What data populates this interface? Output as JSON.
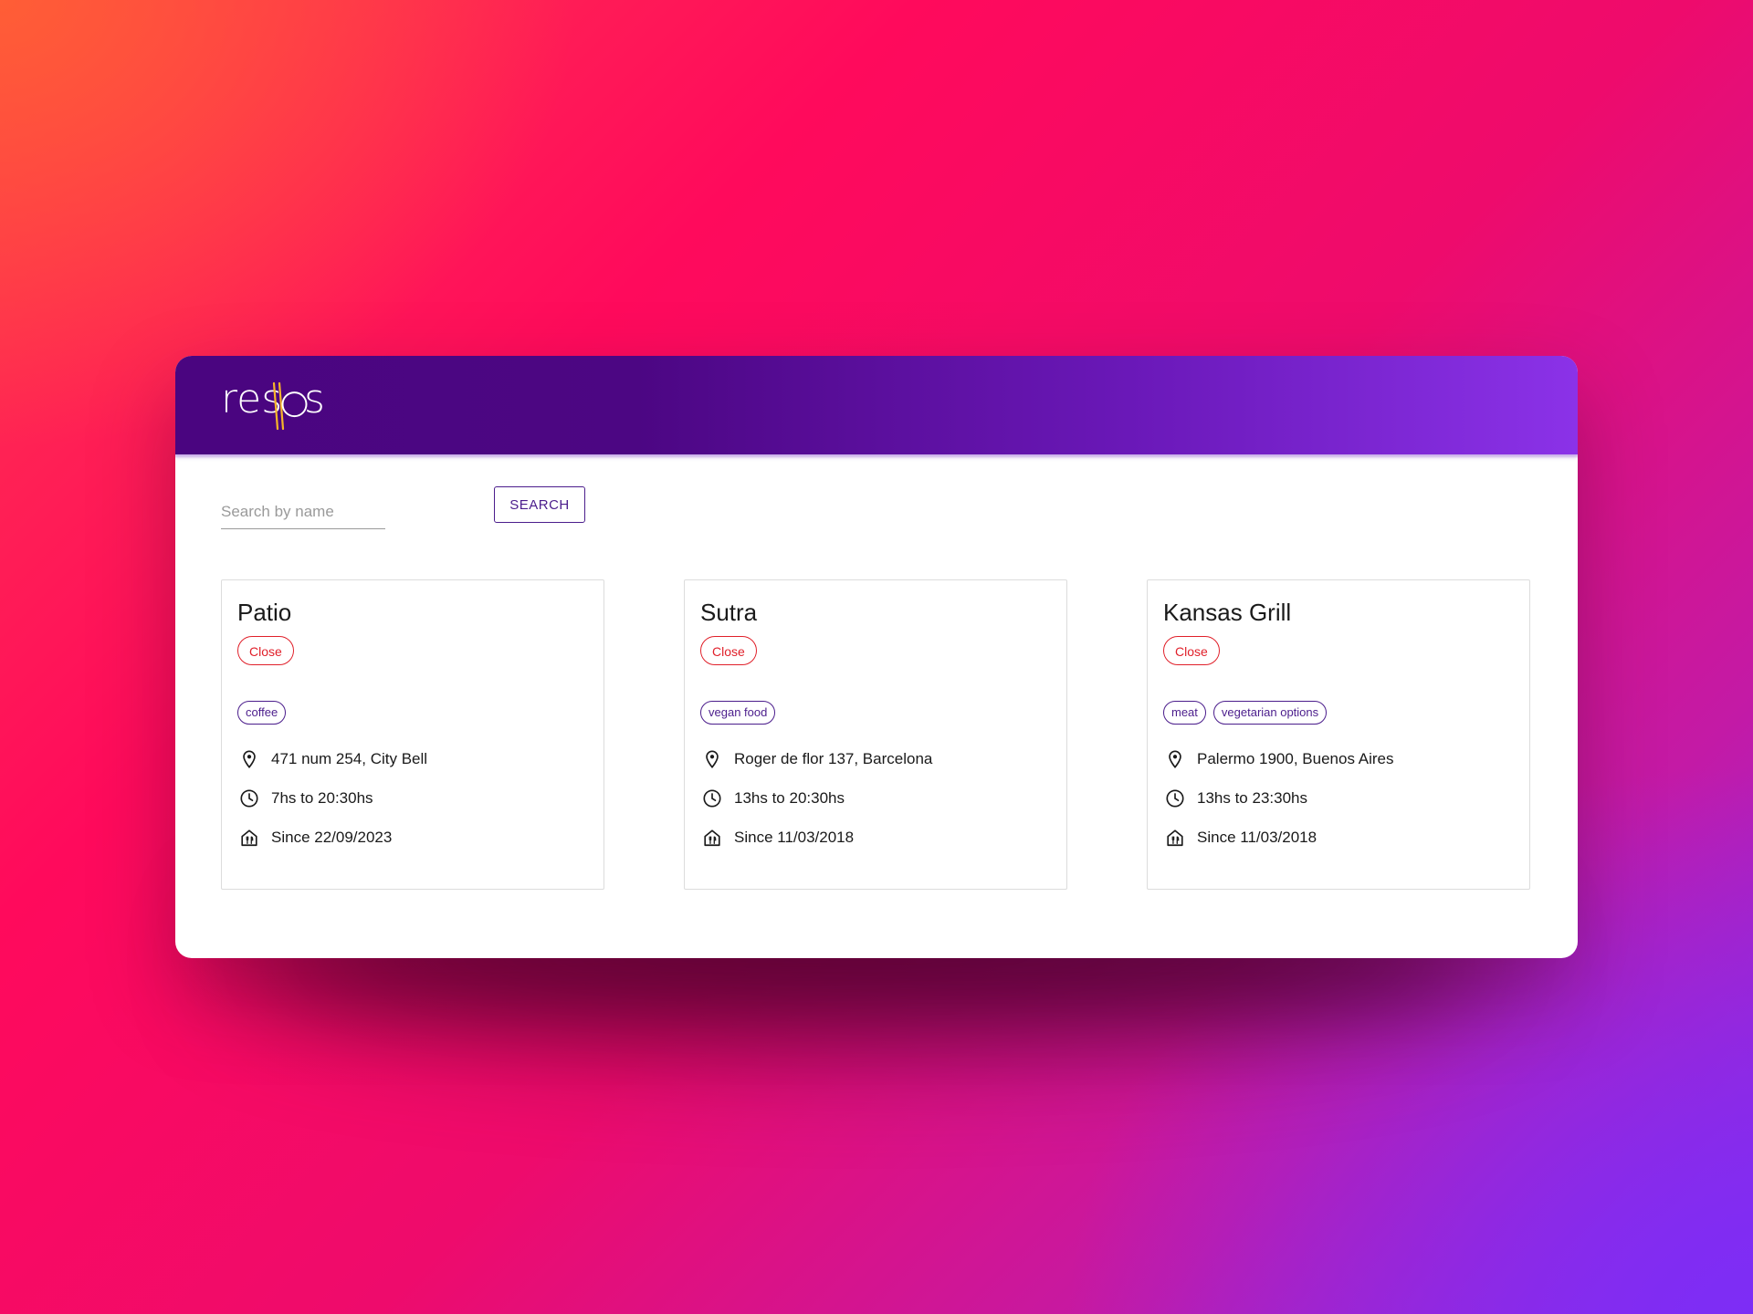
{
  "app": {
    "logo_text_left": "res",
    "logo_text_right": "s",
    "colors": {
      "header_start": "#4a0580",
      "header_end": "#8b32e8",
      "accent": "#4b1d8c",
      "status_closed": "#e0202a"
    }
  },
  "search": {
    "placeholder": "Search by name",
    "value": "",
    "button_label": "SEARCH"
  },
  "restaurants": [
    {
      "name": "Patio",
      "status": "Close",
      "tags": [
        "coffee"
      ],
      "address": "471 num 254, City Bell",
      "hours": "7hs to 20:30hs",
      "since": "Since 22/09/2023"
    },
    {
      "name": "Sutra",
      "status": "Close",
      "tags": [
        "vegan food"
      ],
      "address": "Roger de flor 137, Barcelona",
      "hours": "13hs to 20:30hs",
      "since": "Since 11/03/2018"
    },
    {
      "name": "Kansas Grill",
      "status": "Close",
      "tags": [
        "meat",
        "vegetarian options"
      ],
      "address": "Palermo 1900, Buenos Aires",
      "hours": "13hs to 23:30hs",
      "since": "Since 11/03/2018"
    }
  ],
  "icons": {
    "address": "location-pin-icon",
    "hours": "clock-icon",
    "since": "restaurant-building-icon",
    "logo_mark": "chopsticks-icon"
  }
}
